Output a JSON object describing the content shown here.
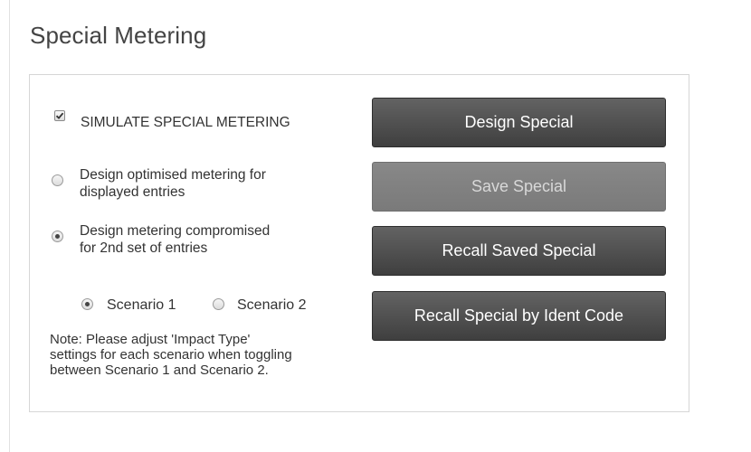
{
  "page": {
    "title": "Special Metering"
  },
  "options": {
    "simulate": {
      "label": "SIMULATE SPECIAL METERING",
      "checked": true
    },
    "optimised": {
      "line1": "Design optimised metering for",
      "line2": "displayed entries",
      "selected": false
    },
    "compromised": {
      "line1": "Design metering compromised",
      "line2": "for 2nd set of entries",
      "selected": true
    },
    "scenario1": {
      "label": "Scenario 1",
      "selected": true
    },
    "scenario2": {
      "label": "Scenario 2",
      "selected": false
    }
  },
  "note": {
    "line1": "Note: Please adjust 'Impact Type'",
    "line2": "settings for each scenario when toggling",
    "line3": "between Scenario 1 and Scenario 2."
  },
  "buttons": {
    "design": {
      "label": "Design Special",
      "enabled": true
    },
    "save": {
      "label": "Save Special",
      "enabled": false
    },
    "recall": {
      "label": "Recall Saved Special",
      "enabled": true
    },
    "recall_ident": {
      "label": "Recall Special by Ident Code",
      "enabled": true
    }
  }
}
